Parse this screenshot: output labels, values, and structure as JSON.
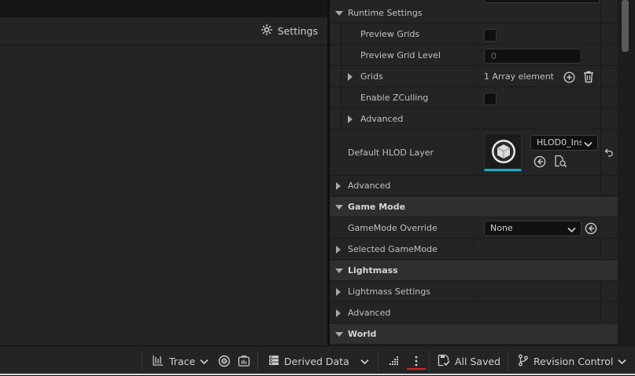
{
  "viewport": {
    "settings_label": "Settings"
  },
  "details": {
    "runtime_settings": "Runtime Settings",
    "preview_grids": "Preview Grids",
    "preview_grid_level": "Preview Grid Level",
    "preview_grid_level_value": "0",
    "grids": "Grids",
    "grids_value": "1 Array element",
    "enable_zculling": "Enable ZCulling",
    "advanced_1": "Advanced",
    "default_hlod_layer": "Default HLOD Layer",
    "hlod_layer_value": "HLOD0_Ins",
    "advanced_2": "Advanced",
    "game_mode": "Game Mode",
    "gamemode_override": "GameMode Override",
    "gamemode_override_value": "None",
    "selected_gamemode": "Selected GameMode",
    "lightmass": "Lightmass",
    "lightmass_settings": "Lightmass Settings",
    "advanced_3": "Advanced",
    "world": "World"
  },
  "statusbar": {
    "trace": "Trace",
    "derived_data": "Derived Data",
    "all_saved": "All Saved",
    "revision_control": "Revision Control"
  },
  "colors": {
    "accent_cyan": "#1fa8c8",
    "underline_red": "#e02020"
  }
}
